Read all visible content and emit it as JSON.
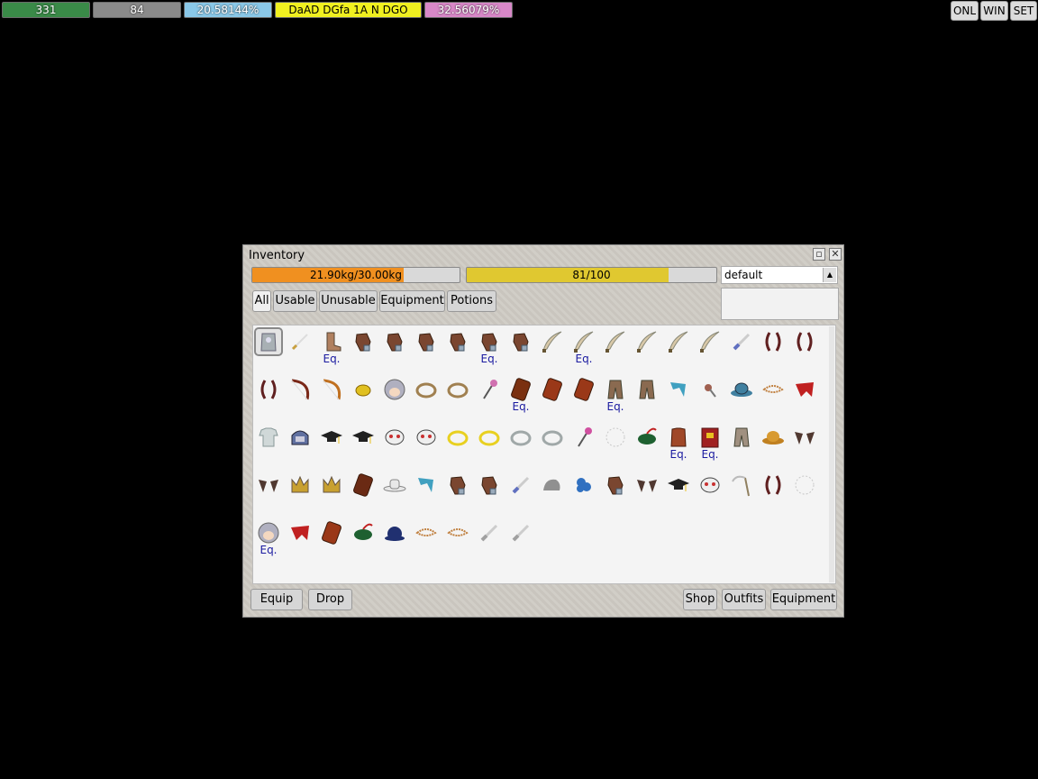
{
  "hud": {
    "hp": "331",
    "mp": "84",
    "xp": "20.58144%",
    "job": "DaAD DGfa 1A N DGO",
    "extra": "32.56079%",
    "buttons": [
      "ONL",
      "WIN",
      "SET"
    ]
  },
  "inventory": {
    "title": "Inventory",
    "weight": {
      "label": "21.90kg/30.00kg",
      "fraction": 0.73
    },
    "slots": {
      "label": "81/100",
      "fraction": 0.81
    },
    "filter": "default",
    "tabs": [
      "All",
      "Usable",
      "Unusable",
      "Equipment",
      "Potions"
    ],
    "active_tab": "All",
    "equipped_label": "Eq.",
    "items": [
      {
        "icon": "armor-icon",
        "color": "#a8b0b4",
        "selected": true
      },
      {
        "icon": "knife-icon",
        "color": "#c8a040"
      },
      {
        "icon": "boot-icon",
        "color": "#b08060",
        "eq": "Eq."
      },
      {
        "icon": "glove-icon",
        "color": "#7a4630"
      },
      {
        "icon": "glove-icon",
        "color": "#7a4630"
      },
      {
        "icon": "glove-icon",
        "color": "#7a4630"
      },
      {
        "icon": "glove-icon",
        "color": "#7a4630"
      },
      {
        "icon": "glove-icon",
        "color": "#7a4630",
        "eq": "Eq."
      },
      {
        "icon": "glove-icon",
        "color": "#7a4630"
      },
      {
        "icon": "scimitar-icon",
        "color": "#d8c8a8"
      },
      {
        "icon": "scimitar-icon",
        "color": "#d8c8a8",
        "eq": "Eq."
      },
      {
        "icon": "scimitar-icon",
        "color": "#d8c8a8"
      },
      {
        "icon": "scimitar-icon",
        "color": "#d8c8a8"
      },
      {
        "icon": "scimitar-icon",
        "color": "#d8c8a8"
      },
      {
        "icon": "scimitar-icon",
        "color": "#d8c8a8"
      },
      {
        "icon": "dagger-icon",
        "color": "#6070c0"
      },
      {
        "icon": "bow-icon",
        "color": "#602020"
      },
      {
        "icon": "bow-icon",
        "color": "#602020"
      },
      {
        "icon": "bow-icon",
        "color": "#602020"
      },
      {
        "icon": "longbow-icon",
        "color": "#7a2818"
      },
      {
        "icon": "longbow-icon",
        "color": "#c07020"
      },
      {
        "icon": "gem-icon",
        "color": "#e0c020"
      },
      {
        "icon": "wig-icon",
        "color": "#b0b0c0"
      },
      {
        "icon": "ring-icon",
        "color": "#a08050"
      },
      {
        "icon": "ring-icon",
        "color": "#a08050"
      },
      {
        "icon": "wand-icon",
        "color": "#d070b0"
      },
      {
        "icon": "shield-icon",
        "color": "#7a3010",
        "eq": "Eq."
      },
      {
        "icon": "shield-icon",
        "color": "#9a3818"
      },
      {
        "icon": "shield-icon",
        "color": "#9a3818"
      },
      {
        "icon": "pants-icon",
        "color": "#8a6a50",
        "eq": "Eq."
      },
      {
        "icon": "pants-icon",
        "color": "#8a6a50"
      },
      {
        "icon": "scarf-icon",
        "color": "#40a0c0"
      },
      {
        "icon": "charm-icon",
        "color": "#a06050"
      },
      {
        "icon": "hat-icon",
        "color": "#4080a0"
      },
      {
        "icon": "bracelet-icon",
        "color": "#c08040"
      },
      {
        "icon": "cape-icon",
        "color": "#c02020"
      },
      {
        "icon": "shirt-icon",
        "color": "#d0d8d8"
      },
      {
        "icon": "helmet-icon",
        "color": "#6070a0"
      },
      {
        "icon": "gradcap-icon",
        "color": "#202020"
      },
      {
        "icon": "gradcap-icon",
        "color": "#202020"
      },
      {
        "icon": "mask-icon",
        "color": "#c83030"
      },
      {
        "icon": "mask-icon",
        "color": "#c83030"
      },
      {
        "icon": "ring-icon",
        "color": "#e8d020"
      },
      {
        "icon": "ring-icon",
        "color": "#e8d020"
      },
      {
        "icon": "ring-icon",
        "color": "#a0a8a8"
      },
      {
        "icon": "ring-icon",
        "color": "#a0a8a8"
      },
      {
        "icon": "wand-icon",
        "color": "#d050a0"
      },
      {
        "icon": "fluff-icon",
        "color": "#c8c8c8"
      },
      {
        "icon": "feather-hat-icon",
        "color": "#1e6030"
      },
      {
        "icon": "vest-icon",
        "color": "#a04828",
        "eq": "Eq."
      },
      {
        "icon": "book-icon",
        "color": "#a02020",
        "eq": "Eq."
      },
      {
        "icon": "pants-icon",
        "color": "#a09080"
      },
      {
        "icon": "straw-hat-icon",
        "color": "#c08020"
      },
      {
        "icon": "ears-icon",
        "color": "#503830"
      },
      {
        "icon": "ears-icon",
        "color": "#503830"
      },
      {
        "icon": "crown-icon",
        "color": "#c8a030"
      },
      {
        "icon": "crown-icon",
        "color": "#c8a030"
      },
      {
        "icon": "shield-icon",
        "color": "#6a2a14"
      },
      {
        "icon": "cowboy-hat-icon",
        "color": "#e8e8e8"
      },
      {
        "icon": "scarf-icon",
        "color": "#40a0c0"
      },
      {
        "icon": "glove-icon",
        "color": "#7a4630"
      },
      {
        "icon": "glove-icon",
        "color": "#7a4630"
      },
      {
        "icon": "dagger-icon",
        "color": "#6070c0"
      },
      {
        "icon": "cap-icon",
        "color": "#909090"
      },
      {
        "icon": "flower-icon",
        "color": "#3070c0"
      },
      {
        "icon": "glove-icon",
        "color": "#7a4630"
      },
      {
        "icon": "ears-icon",
        "color": "#503830"
      },
      {
        "icon": "gradcap-icon",
        "color": "#202020"
      },
      {
        "icon": "mask-icon",
        "color": "#c83030"
      },
      {
        "icon": "scythe-icon",
        "color": "#908060"
      },
      {
        "icon": "bow-icon",
        "color": "#602020"
      },
      {
        "icon": "fluff-icon",
        "color": "#c8c8c8"
      },
      {
        "icon": "wig-icon",
        "color": "#b0b0c0",
        "eq": "Eq."
      },
      {
        "icon": "cape-icon",
        "color": "#c02020"
      },
      {
        "icon": "shield-icon",
        "color": "#9a3818"
      },
      {
        "icon": "feather-hat-icon",
        "color": "#1e6030"
      },
      {
        "icon": "bowler-hat-icon",
        "color": "#203070"
      },
      {
        "icon": "bracelet-icon",
        "color": "#c08040"
      },
      {
        "icon": "bracelet-icon",
        "color": "#c08040"
      },
      {
        "icon": "dagger-icon",
        "color": "#a0a0a0"
      },
      {
        "icon": "dagger-icon",
        "color": "#a0a0a0"
      }
    ]
  },
  "buttons": {
    "equip": "Equip",
    "drop": "Drop",
    "shop": "Shop",
    "outfits": "Outfits",
    "equipment": "Equipment"
  },
  "colors": {
    "hp": "#3a8a48",
    "mp": "#8a8a8a",
    "xp": "#8ac8e8",
    "job": "#f0f020",
    "extra": "#d888c8",
    "weight_fill": "#f09020",
    "slots_fill": "#e0c830"
  }
}
